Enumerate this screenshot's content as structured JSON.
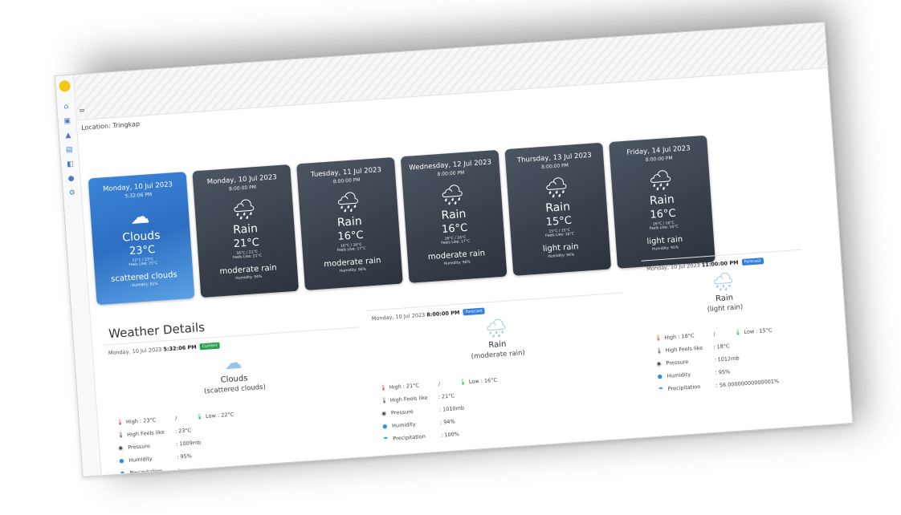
{
  "location_label": "Location: Tringkap",
  "menu_glyph": "=",
  "sidebar_icons": [
    "home-icon",
    "box-icon",
    "chart-icon",
    "file-icon",
    "tag-icon",
    "bell-icon",
    "settings-icon"
  ],
  "cards": [
    {
      "date": "Monday, 10 Jul 2023",
      "time": "5:32:06 PM",
      "main": "Clouds",
      "temp": "23°C",
      "minmax": "22°C / 23°C",
      "feels": "Feels Like: 23°C",
      "desc": "scattered clouds",
      "humidity": "Humidity: 81%",
      "current": true,
      "icon": "cloud-icon"
    },
    {
      "date": "Monday, 10 Jul 2023",
      "time": "8:00:00 PM",
      "main": "Rain",
      "temp": "21°C",
      "minmax": "16°C / 21°C",
      "feels": "Feels Like: 21°C",
      "desc": "moderate rain",
      "humidity": "Humidity: 94%",
      "current": false,
      "icon": "rain-cloud-icon"
    },
    {
      "date": "Tuesday, 11 Jul 2023",
      "time": "8:00:00 PM",
      "main": "Rain",
      "temp": "16°C",
      "minmax": "16°C / 16°C",
      "feels": "Feels Like: 17°C",
      "desc": "moderate rain",
      "humidity": "Humidity: 96%",
      "current": false,
      "icon": "rain-cloud-icon"
    },
    {
      "date": "Wednesday, 12 Jul 2023",
      "time": "8:00:00 PM",
      "main": "Rain",
      "temp": "16°C",
      "minmax": "16°C / 16°C",
      "feels": "Feels Like: 17°C",
      "desc": "moderate rain",
      "humidity": "Humidity: 96%",
      "current": false,
      "icon": "rain-cloud-icon"
    },
    {
      "date": "Thursday, 13 Jul 2023",
      "time": "8:00:00 PM",
      "main": "Rain",
      "temp": "15°C",
      "minmax": "15°C / 15°C",
      "feels": "Feels Like: 16°C",
      "desc": "light rain",
      "humidity": "Humidity: 96%",
      "current": false,
      "icon": "rain-cloud-icon"
    },
    {
      "date": "Friday, 14 Jul 2023",
      "time": "8:00:00 PM",
      "main": "Rain",
      "temp": "16°C",
      "minmax": "16°C / 16°C",
      "feels": "Feels Like: 16°C",
      "desc": "light rain",
      "humidity": "Humidity: 95%",
      "current": false,
      "icon": "rain-cloud-icon"
    }
  ],
  "details_title": "Weather Details",
  "details": [
    {
      "date": "Monday, 10 Jul 2023",
      "time": "5:32:06 PM",
      "badge": "Current",
      "badge_color": "#2e9e4f",
      "main": "Clouds",
      "sub": "(scattered clouds)",
      "icon": "cloud-icon",
      "high_label": "High",
      "high": ": 23°C",
      "low_label": "Low",
      "low": ": 22°C",
      "sep": "/",
      "feels_label": "High Feels like",
      "feels": ": 23°C",
      "pressure_label": "Pressure",
      "pressure": ": 1009mb",
      "humidity_label": "Humidity",
      "humidity": ": 95%",
      "precip_label": "Precipitation",
      "precip": ": -"
    },
    {
      "date": "Monday, 10 Jul 2023",
      "time": "8:00:00 PM",
      "badge": "Forecast",
      "badge_color": "#2f7fe0",
      "main": "Rain",
      "sub": "(moderate rain)",
      "icon": "rain-cloud-icon",
      "high_label": "High",
      "high": ": 21°C",
      "low_label": "Low",
      "low": ": 16°C",
      "sep": "/",
      "feels_label": "High Feels like",
      "feels": ": 21°C",
      "pressure_label": "Pressure",
      "pressure": ": 1010mb",
      "humidity_label": "Humidity",
      "humidity": ": 94%",
      "precip_label": "Precipitation",
      "precip": ": 100%"
    },
    {
      "date": "Monday, 10 Jul 2023",
      "time": "11:00:00 PM",
      "badge": "Forecast",
      "badge_color": "#2f7fe0",
      "main": "Rain",
      "sub": "(light rain)",
      "icon": "rain-cloud-icon",
      "high_label": "High",
      "high": ": 18°C",
      "low_label": "Low",
      "low": ": 15°C",
      "sep": "/",
      "feels_label": "High Feels like",
      "feels": ": 18°C",
      "pressure_label": "Pressure",
      "pressure": ": 1012mb",
      "humidity_label": "Humidity",
      "humidity": ": 95%",
      "precip_label": "Precipitation",
      "precip": ": 56.00000000000001%"
    }
  ]
}
